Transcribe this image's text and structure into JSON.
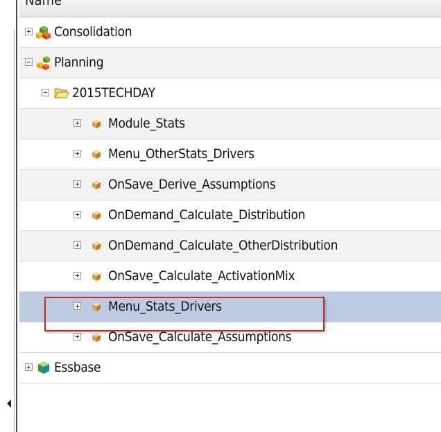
{
  "header": {
    "column_label": "Name"
  },
  "tree": {
    "rows": [
      {
        "label": "Consolidation",
        "icon": "consolidation-cubes-icon",
        "expander": "plus"
      },
      {
        "label": "Planning",
        "icon": "planning-cubes-icon",
        "expander": "minus"
      },
      {
        "label": "2015TECHDAY",
        "icon": "folder-open-icon",
        "expander": "minus"
      },
      {
        "label": "Module_Stats",
        "icon": "rule-cube-icon",
        "expander": "plus"
      },
      {
        "label": "Menu_OtherStats_Drivers",
        "icon": "rule-cube-icon",
        "expander": "plus"
      },
      {
        "label": "OnSave_Derive_Assumptions",
        "icon": "rule-cube-icon",
        "expander": "plus"
      },
      {
        "label": "OnDemand_Calculate_Distribution",
        "icon": "rule-cube-icon",
        "expander": "plus"
      },
      {
        "label": "OnDemand_Calculate_OtherDistribution",
        "icon": "rule-cube-icon",
        "expander": "plus"
      },
      {
        "label": "OnSave_Calculate_ActivationMix",
        "icon": "rule-cube-icon",
        "expander": "plus"
      },
      {
        "label": "Menu_Stats_Drivers",
        "icon": "rule-cube-icon",
        "expander": "plus",
        "selected": true
      },
      {
        "label": "OnSave_Calculate_Assumptions",
        "icon": "rule-cube-icon",
        "expander": "plus"
      },
      {
        "label": "Essbase",
        "icon": "essbase-cube-icon",
        "expander": "plus"
      }
    ]
  },
  "colors": {
    "selected_row": "#bccbe2",
    "alt_row": "#f2f2f2",
    "highlight_border": "#c0292b"
  }
}
